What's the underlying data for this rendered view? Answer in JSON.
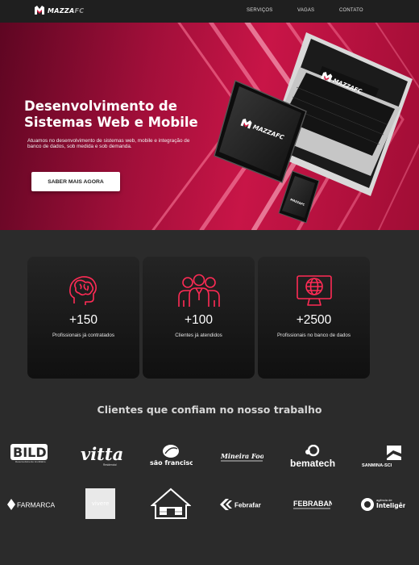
{
  "nav": {
    "brand_main": "MAZZA",
    "brand_suffix": "FC",
    "links": [
      "SERVIÇOS",
      "VAGAS",
      "CONTATO"
    ]
  },
  "hero": {
    "title_line1": "Desenvolvimento de",
    "title_line2": "Sistemas Web e Mobile",
    "subtitle": "Atuamos no desenvolvimento de sistemas web, mobile e integração de banco de dados, sob medida e sob demanda.",
    "cta_label": "SABER MAIS AGORA",
    "device_brand": "MAZZAFC"
  },
  "stats": [
    {
      "icon": "brain-icon",
      "value": "+150",
      "label": "Profissionais já contratados"
    },
    {
      "icon": "team-icon",
      "value": "+100",
      "label": "Clientes já atendidos"
    },
    {
      "icon": "globe-monitor-icon",
      "value": "+2500",
      "label": "Profissionais no banco de dados"
    }
  ],
  "clients": {
    "title": "Clientes que  confiam no nosso trabalho",
    "logos": [
      {
        "name": "BILD",
        "tagline": "Desenvolvimento Imobiliário"
      },
      {
        "name": "vitta",
        "tagline": "Residencial"
      },
      {
        "name": "são francisco"
      },
      {
        "name": "Mineira Foods"
      },
      {
        "name": "bematech"
      },
      {
        "name": "SANMINA-SCI"
      },
      {
        "name": "FARMARCAS"
      },
      {
        "name": "vivere"
      },
      {
        "name": "house-logo"
      },
      {
        "name": "Febrafar"
      },
      {
        "name": "FEBRABAN"
      },
      {
        "name": "Inteligência",
        "tagline": "agência de"
      }
    ]
  },
  "colors": {
    "accent": "#e3143f",
    "hero_dark": "#5e0622",
    "hero_mid": "#c81547",
    "background": "#2b2b2b",
    "nav": "#1f1f1f",
    "card": "#151515"
  }
}
